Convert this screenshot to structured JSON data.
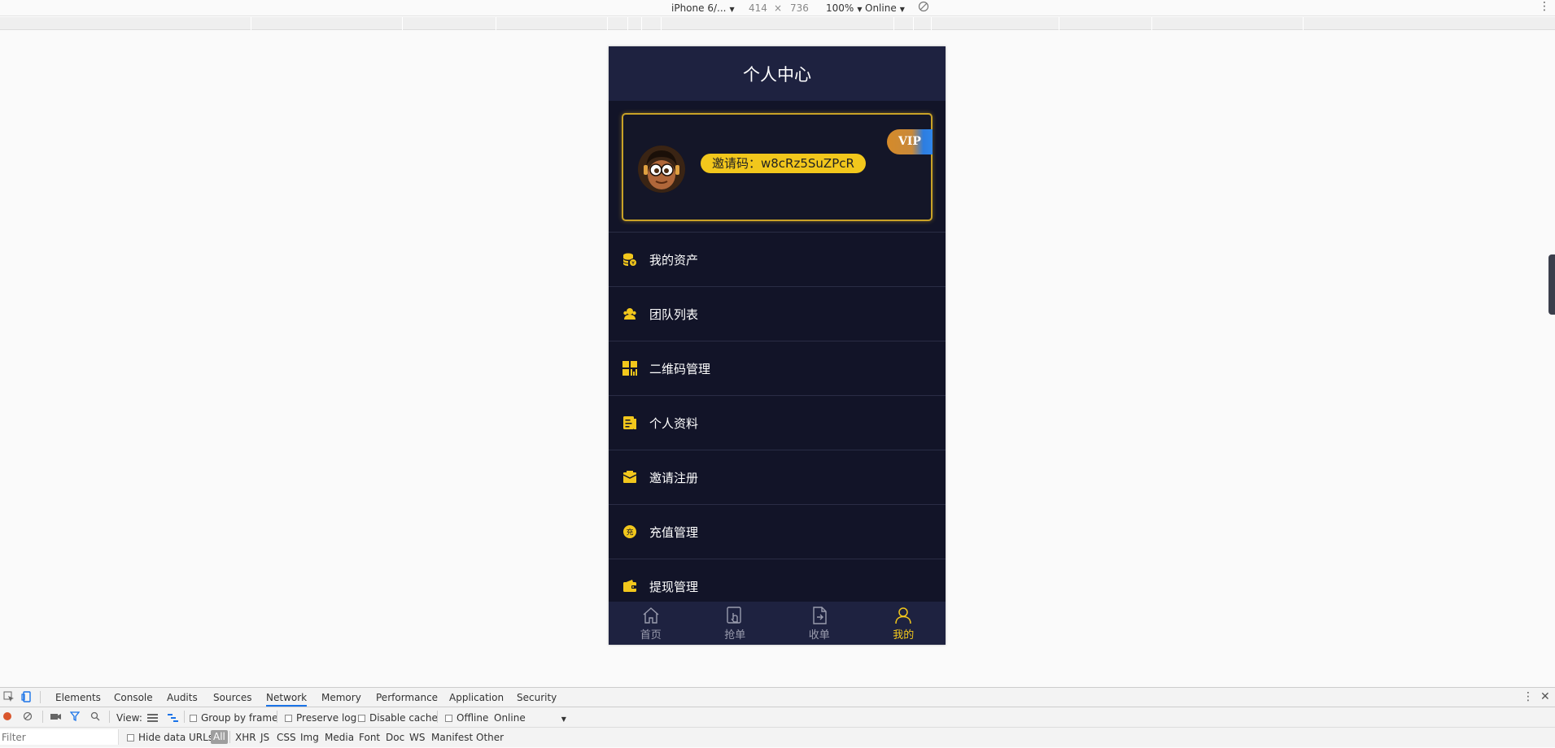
{
  "device_toolbar": {
    "device": "iPhone 6/...",
    "width": "414",
    "times": "×",
    "height": "736",
    "zoom": "100%",
    "throttle": "Online"
  },
  "app": {
    "title": "个人中心",
    "invite_code": "邀请码：w8cRz5SuZPcR",
    "vip_badge": "VIP",
    "menu": [
      {
        "label": "我的资产",
        "icon": "coins-icon"
      },
      {
        "label": "团队列表",
        "icon": "team-icon"
      },
      {
        "label": "二维码管理",
        "icon": "qrcode-icon"
      },
      {
        "label": "个人资料",
        "icon": "profile-doc-icon"
      },
      {
        "label": "邀请注册",
        "icon": "invite-mail-icon"
      },
      {
        "label": "充值管理",
        "icon": "recharge-icon"
      },
      {
        "label": "提现管理",
        "icon": "wallet-icon"
      }
    ],
    "tabs": [
      {
        "label": "首页",
        "icon": "home-icon",
        "active": false
      },
      {
        "label": "抢单",
        "icon": "grab-order-icon",
        "active": false
      },
      {
        "label": "收单",
        "icon": "receive-order-icon",
        "active": false
      },
      {
        "label": "我的",
        "icon": "user-icon",
        "active": true
      }
    ],
    "colors": {
      "header_bg": "#1e2240",
      "body_bg": "#121428",
      "accent": "#f2c71c",
      "tab_inactive": "#9a9cae"
    }
  },
  "devtools": {
    "tabs": [
      "Elements",
      "Console",
      "Audits",
      "Sources",
      "Network",
      "Memory",
      "Performance",
      "Application",
      "Security"
    ],
    "active_tab": "Network",
    "view_label": "View:",
    "group_by_frame": "Group by frame",
    "preserve_log": "Preserve log",
    "disable_cache": "Disable cache",
    "offline": "Offline",
    "throttle": "Online",
    "filter_placeholder": "Filter",
    "hide_data_urls": "Hide data URLs",
    "types": [
      "All",
      "XHR",
      "JS",
      "CSS",
      "Img",
      "Media",
      "Font",
      "Doc",
      "WS",
      "Manifest",
      "Other"
    ]
  }
}
